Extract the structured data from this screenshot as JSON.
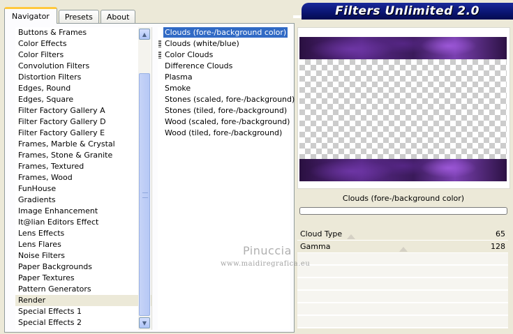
{
  "tabs": [
    {
      "label": "Navigator",
      "active": true
    },
    {
      "label": "Presets",
      "active": false
    },
    {
      "label": "About",
      "active": false
    }
  ],
  "banner": {
    "title": "Filters Unlimited 2.0"
  },
  "categories": [
    "Buttons & Frames",
    "Color Effects",
    "Color Filters",
    "Convolution Filters",
    "Distortion Filters",
    "Edges, Round",
    "Edges, Square",
    "Filter Factory Gallery A",
    "Filter Factory Gallery D",
    "Filter Factory Gallery E",
    "Frames, Marble & Crystal",
    "Frames, Stone & Granite",
    "Frames, Textured",
    "Frames, Wood",
    "FunHouse",
    "Gradients",
    "Image Enhancement",
    "It@lian Editors Effect",
    "Lens Effects",
    "Lens Flares",
    "Noise Filters",
    "Paper Backgrounds",
    "Paper Textures",
    "Pattern Generators",
    "Render",
    "Special Effects 1",
    "Special Effects 2"
  ],
  "selected_category": "Render",
  "filters": [
    "Clouds (fore-/background color)",
    "Clouds (white/blue)",
    "Color Clouds",
    "Difference Clouds",
    "Plasma",
    "Smoke",
    "Stones (scaled, fore-/background)",
    "Stones (tiled, fore-/background)",
    "Wood (scaled, fore-/background)",
    "Wood (tiled, fore-/background)"
  ],
  "selected_filter": "Clouds (fore-/background color)",
  "preview": {
    "filter_name": "Clouds (fore-/background color)"
  },
  "controls": [
    {
      "label": "Cloud Type",
      "value": "65",
      "level": 65
    },
    {
      "label": "Gamma",
      "value": "128",
      "level": 128
    }
  ],
  "watermark": {
    "name": "Pinuccia",
    "url": "www.maidiregrafica.eu"
  },
  "icons": {
    "scroll_up": "chevron-up-icon",
    "scroll_down": "chevron-down-icon"
  }
}
